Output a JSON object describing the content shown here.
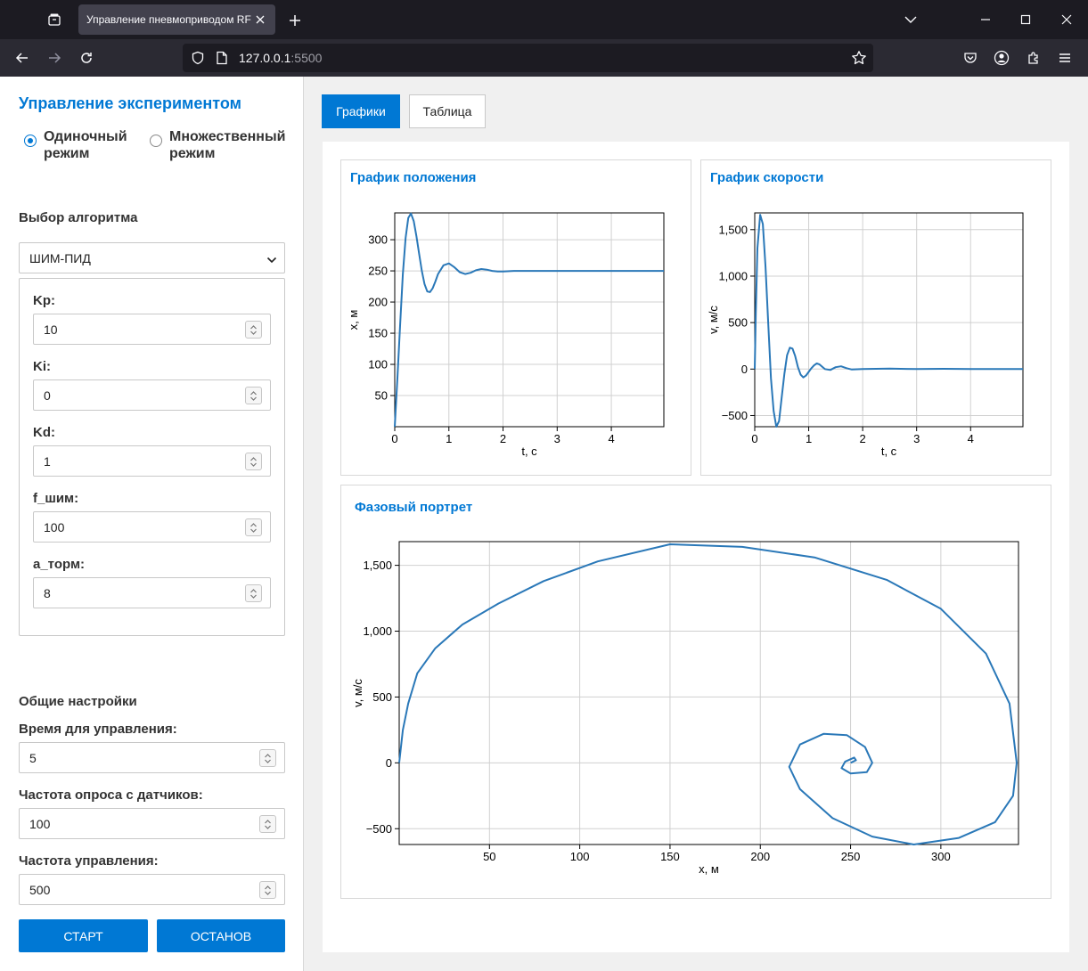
{
  "browser": {
    "tab_title": "Управление пневмоприводом RF",
    "url_host": "127.0.0.1",
    "url_port": ":5500",
    "icons": [
      "tab-list-icon",
      "close-icon",
      "plus-icon",
      "chevron-down-icon",
      "minimize-icon",
      "maximize-icon",
      "close-window-icon",
      "back-icon",
      "forward-icon",
      "reload-icon",
      "shield-icon",
      "page-icon",
      "star-icon",
      "pocket-icon",
      "account-icon",
      "extensions-icon",
      "menu-icon"
    ]
  },
  "sidebar": {
    "title": "Управление экспериментом",
    "modes": [
      {
        "label": "Одиночный режим",
        "checked": true
      },
      {
        "label": "Множественный режим",
        "checked": false
      }
    ],
    "algorithm_label": "Выбор алгоритма",
    "algorithm_value": "ШИМ-ПИД",
    "params": [
      {
        "label": "Kp:",
        "value": "10"
      },
      {
        "label": "Ki:",
        "value": "0"
      },
      {
        "label": "Kd:",
        "value": "1"
      },
      {
        "label": "f_шим:",
        "value": "100"
      },
      {
        "label": "a_торм:",
        "value": "8"
      }
    ],
    "general_label": "Общие настройки",
    "general": [
      {
        "label": "Время для управления:",
        "value": "5"
      },
      {
        "label": "Частота опроса с датчиков:",
        "value": "100"
      },
      {
        "label": "Частота управления:",
        "value": "500"
      }
    ],
    "start_label": "СТАРТ",
    "stop_label": "ОСТАНОВ"
  },
  "main": {
    "tabs": [
      {
        "label": "Графики",
        "active": true
      },
      {
        "label": "Таблица",
        "active": false
      }
    ]
  },
  "chart_data": [
    {
      "type": "line",
      "title": "График положения",
      "xlabel": "t, с",
      "ylabel": "x, м",
      "xlim": [
        0,
        4.97
      ],
      "ylim": [
        0,
        343
      ],
      "xticks": [
        0,
        1,
        2,
        3,
        4
      ],
      "yticks": [
        50,
        100,
        150,
        200,
        250,
        300
      ],
      "grid": true,
      "series": [
        {
          "x": [
            0,
            0.05,
            0.1,
            0.15,
            0.2,
            0.25,
            0.3,
            0.35,
            0.4,
            0.45,
            0.5,
            0.55,
            0.6,
            0.65,
            0.7,
            0.75,
            0.8,
            0.9,
            1.0,
            1.1,
            1.2,
            1.3,
            1.4,
            1.5,
            1.6,
            1.7,
            1.8,
            1.9,
            2.0,
            2.2,
            2.4,
            2.6,
            2.8,
            3.0,
            3.5,
            4.0,
            4.5,
            4.97
          ],
          "y": [
            0,
            78,
            165,
            245,
            303,
            335,
            342,
            330,
            306,
            278,
            250,
            229,
            217,
            216,
            222,
            233,
            245,
            259,
            262,
            256,
            248,
            245,
            247,
            251,
            253,
            252,
            250,
            249,
            249,
            250,
            250,
            250,
            250,
            250,
            250,
            250,
            250,
            250
          ]
        }
      ],
      "color": "#2a78b8"
    },
    {
      "type": "line",
      "title": "График скорости",
      "xlabel": "t, с",
      "ylabel": "v, м/с",
      "xlim": [
        0,
        4.97
      ],
      "ylim": [
        -620,
        1680
      ],
      "xticks": [
        0,
        1,
        2,
        3,
        4
      ],
      "yticks": [
        -500,
        0,
        500,
        1000,
        1500
      ],
      "grid": true,
      "series": [
        {
          "x": [
            0,
            0.02,
            0.05,
            0.1,
            0.15,
            0.2,
            0.25,
            0.3,
            0.35,
            0.4,
            0.45,
            0.5,
            0.55,
            0.6,
            0.65,
            0.7,
            0.75,
            0.8,
            0.85,
            0.9,
            0.95,
            1.0,
            1.05,
            1.1,
            1.15,
            1.2,
            1.3,
            1.4,
            1.5,
            1.6,
            1.7,
            1.8,
            2.0,
            2.5,
            3.0,
            3.5,
            4.0,
            4.5,
            4.97
          ],
          "y": [
            0,
            600,
            1300,
            1660,
            1560,
            1100,
            500,
            -100,
            -450,
            -620,
            -560,
            -300,
            -50,
            150,
            230,
            220,
            140,
            20,
            -60,
            -90,
            -70,
            -30,
            10,
            40,
            60,
            50,
            0,
            -10,
            20,
            30,
            10,
            -5,
            0,
            5,
            0,
            3,
            0,
            0,
            0
          ]
        }
      ],
      "color": "#2a78b8"
    },
    {
      "type": "line",
      "title": "Фазовый портрет",
      "xlabel": "x, м",
      "ylabel": "v, м/с",
      "xlim": [
        0,
        343
      ],
      "ylim": [
        -620,
        1680
      ],
      "xticks": [
        50,
        100,
        150,
        200,
        250,
        300
      ],
      "yticks": [
        -500,
        0,
        500,
        1000,
        1500
      ],
      "grid": true,
      "series": [
        {
          "x": [
            0,
            2,
            5,
            10,
            20,
            35,
            55,
            80,
            110,
            150,
            190,
            230,
            270,
            300,
            325,
            338,
            342,
            340,
            330,
            310,
            285,
            262,
            240,
            222,
            216,
            222,
            235,
            248,
            258,
            262,
            259,
            250,
            245,
            247,
            252,
            253,
            250
          ],
          "y": [
            0,
            250,
            450,
            680,
            870,
            1050,
            1210,
            1380,
            1530,
            1660,
            1640,
            1560,
            1390,
            1170,
            830,
            450,
            0,
            -250,
            -450,
            -570,
            -620,
            -560,
            -420,
            -200,
            -30,
            140,
            220,
            210,
            120,
            0,
            -70,
            -80,
            -40,
            10,
            40,
            20,
            0
          ]
        }
      ],
      "color": "#2a78b8"
    }
  ]
}
